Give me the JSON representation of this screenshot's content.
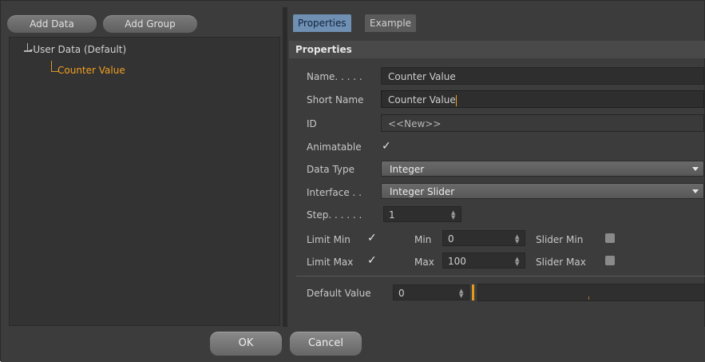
{
  "toolbar": {
    "add_data": "Add Data",
    "add_group": "Add Group"
  },
  "tree": {
    "root_label": "User Data (Default)",
    "child_label": "Counter Value",
    "child_color": "#f0a020"
  },
  "tabs": [
    {
      "label": "Properties",
      "active": true
    },
    {
      "label": "Example",
      "active": false
    }
  ],
  "section": {
    "title": "Properties"
  },
  "properties": {
    "name_label": "Name. . . . .",
    "name_value": "Counter Value",
    "short_name_label": "Short Name",
    "short_name_value": "Counter Value",
    "id_label": "ID",
    "id_value": "<<New>>",
    "animatable_label": "Animatable",
    "animatable_checked": true,
    "data_type_label": "Data Type",
    "data_type_value": "Integer",
    "interface_label": "Interface . .",
    "interface_value": "Integer Slider",
    "step_label": "Step. . . . . .",
    "step_value": "1",
    "limit_min_label": "Limit Min",
    "limit_min_checked": true,
    "min_label": "Min",
    "min_value": "0",
    "slider_min_label": "Slider Min",
    "slider_min_checked": false,
    "limit_max_label": "Limit Max",
    "limit_max_checked": true,
    "max_label": "Max",
    "max_value": "100",
    "slider_max_label": "Slider Max",
    "slider_max_checked": false,
    "default_value_label": "Default Value",
    "default_value": "0"
  },
  "footer": {
    "ok_label": "OK",
    "cancel_label": "Cancel"
  },
  "icons": {
    "checkmark": "checkmark-icon",
    "dropdown": "chevron-down-icon",
    "spinner": "spinner-arrows-icon"
  }
}
